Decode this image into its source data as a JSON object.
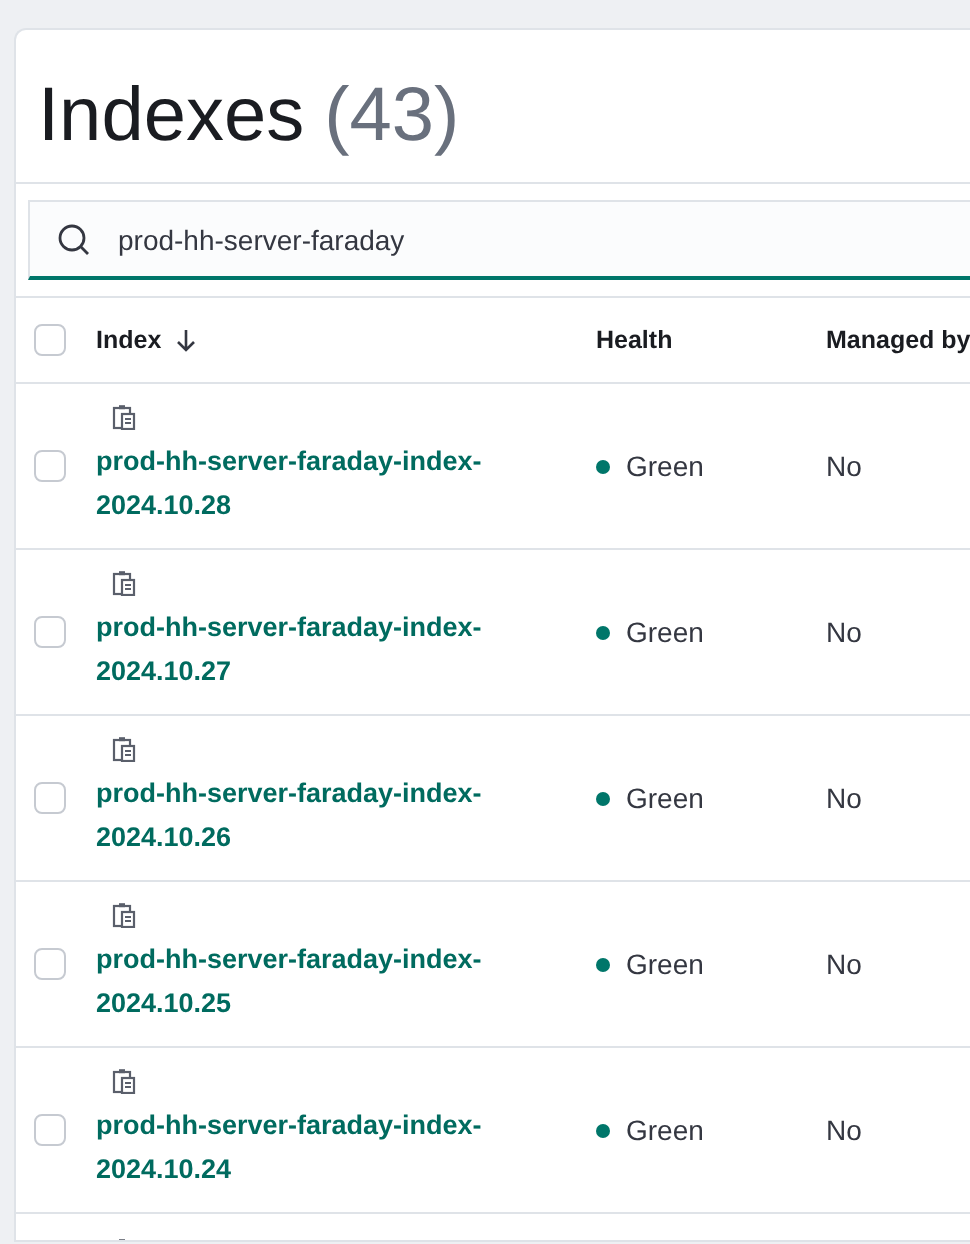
{
  "title": {
    "text": "Indexes",
    "count": "(43)"
  },
  "search": {
    "value": "prod-hh-server-faraday"
  },
  "table": {
    "select_all": {
      "checked": false
    },
    "columns": [
      {
        "label": "Index",
        "sorted": true
      },
      {
        "label": "Health",
        "sorted": false
      },
      {
        "label": "Managed by",
        "sorted": false
      }
    ],
    "rows": [
      {
        "kind": "full",
        "checked": false,
        "name": "prod-hh-server-faraday-index-2024.10.28",
        "health": "Green",
        "color": "#00766a",
        "managed": "No"
      },
      {
        "kind": "full",
        "checked": false,
        "name": "prod-hh-server-faraday-index-2024.10.27",
        "health": "Green",
        "color": "#00766a",
        "managed": "No"
      },
      {
        "kind": "full",
        "checked": false,
        "name": "prod-hh-server-faraday-index-2024.10.26",
        "health": "Green",
        "color": "#00766a",
        "managed": "No"
      },
      {
        "kind": "full",
        "checked": false,
        "name": "prod-hh-server-faraday-index-2024.10.25",
        "health": "Green",
        "color": "#00766a",
        "managed": "No"
      },
      {
        "kind": "full",
        "checked": false,
        "name": "prod-hh-server-faraday-index-2024.10.24",
        "health": "Green",
        "color": "#00766a",
        "managed": "No"
      },
      {
        "kind": "partial"
      }
    ]
  }
}
